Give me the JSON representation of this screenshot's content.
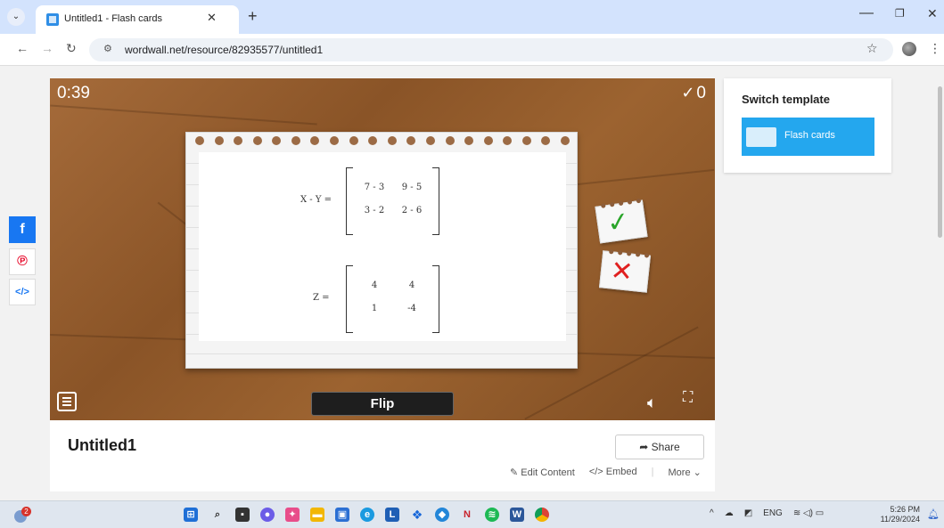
{
  "browser": {
    "tab_title": "Untitled1 - Flash cards",
    "url": "wordwall.net/resource/82935577/untitled1"
  },
  "game": {
    "timer": "0:39",
    "score": "0",
    "flip_label": "Flip",
    "card": {
      "matrix1": {
        "label": "X - Y =",
        "rows": [
          [
            "7 - 3",
            "9 - 5"
          ],
          [
            "3 - 2",
            "2 - 6"
          ]
        ]
      },
      "matrix2": {
        "label": "Z =",
        "rows": [
          [
            "4",
            "4"
          ],
          [
            "1",
            "-4"
          ]
        ]
      }
    }
  },
  "activity": {
    "title": "Untitled1",
    "share_label": "Share",
    "edit_label": "Edit Content",
    "embed_label": "Embed",
    "more_label": "More"
  },
  "template_panel": {
    "heading": "Switch template",
    "option_label": "Flash cards"
  },
  "taskbar": {
    "notification_count": "2",
    "language": "ENG",
    "time": "5:26 PM",
    "date": "11/29/2024"
  },
  "colors": {
    "accent": "#24a7ee",
    "facebook": "#1877f2",
    "pinterest": "#e60023",
    "correct": "#2aa52a",
    "wrong": "#e02020"
  }
}
